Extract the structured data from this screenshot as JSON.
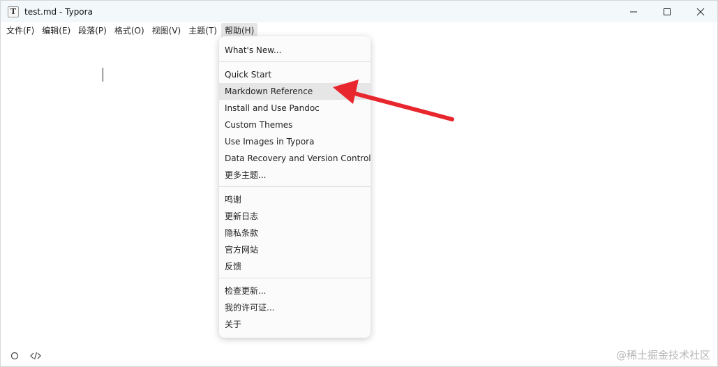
{
  "window": {
    "title": "test.md - Typora",
    "app_icon_letter": "T"
  },
  "menubar": {
    "items": [
      "文件(F)",
      "编辑(E)",
      "段落(P)",
      "格式(O)",
      "视图(V)",
      "主题(T)",
      "帮助(H)"
    ],
    "active": "帮助(H)"
  },
  "help_menu": {
    "groups": [
      [
        "What's New..."
      ],
      [
        "Quick Start",
        "Markdown Reference",
        "Install and Use Pandoc",
        "Custom Themes",
        "Use Images in Typora",
        "Data Recovery and Version Control",
        "更多主题..."
      ],
      [
        "鸣谢",
        "更新日志",
        "隐私条款",
        "官方网站",
        "反馈"
      ],
      [
        "检查更新...",
        "我的许可证...",
        "关于"
      ]
    ],
    "highlighted": "Markdown Reference"
  },
  "annotation": {
    "arrow_color": "#e8262d"
  },
  "watermark": "@稀土掘金技术社区",
  "colors": {
    "titlebar_bg": "#f3f9fb",
    "menu_active_bg": "#e6e6e6",
    "dropdown_bg": "#fbfbfb",
    "arrow": "#e8262d"
  }
}
